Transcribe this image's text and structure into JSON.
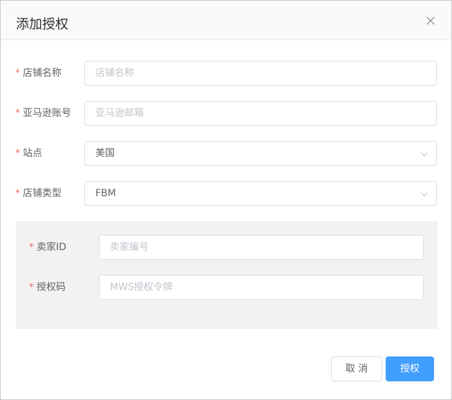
{
  "dialog": {
    "title": "添加授权",
    "close_icon": "close-icon"
  },
  "form": {
    "required_mark": "*",
    "store_name": {
      "label": "店铺名称",
      "value": "",
      "placeholder": "店铺名称"
    },
    "amazon_account": {
      "label": "亚马逊账号",
      "value": "",
      "placeholder": "亚马逊邮箱"
    },
    "site": {
      "label": "站点",
      "selected": "美国",
      "icon": "chevron-down-icon"
    },
    "store_type": {
      "label": "店铺类型",
      "selected": "FBM",
      "icon": "chevron-down-icon"
    },
    "seller_id": {
      "label": "卖家ID",
      "value": "",
      "placeholder": "卖家编号"
    },
    "auth_code": {
      "label": "授权码",
      "value": "",
      "placeholder": "MWS授权令牌"
    }
  },
  "footer": {
    "cancel_label": "取 消",
    "confirm_label": "授权"
  },
  "colors": {
    "primary": "#409eff",
    "required": "#f56c6c",
    "border": "#dcdfe6",
    "panel_bg": "#f2f2f2"
  }
}
